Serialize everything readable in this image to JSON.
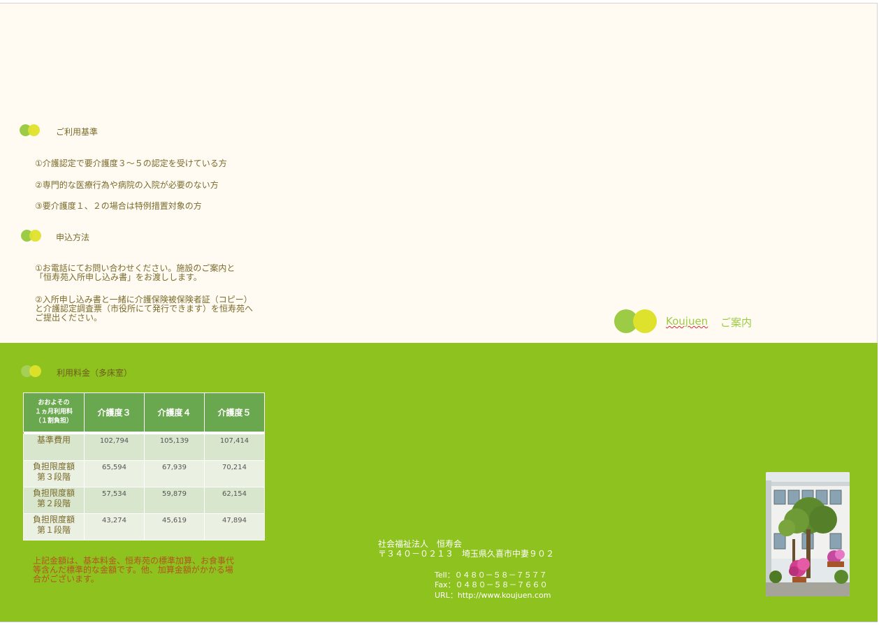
{
  "criteria": {
    "heading": "ご利用基準",
    "items": [
      "①介護認定で要介護度３～５の認定を受けている方",
      "②専門的な医療行為や病院の入院が必要のない方",
      "③要介護度１、２の場合は特例措置対象の方"
    ]
  },
  "application": {
    "heading": "申込方法",
    "step1": "①お電話にてお問い合わせください。施設のご案内と\n「恒寿苑入所申し込み書」をお渡しします。",
    "step2": "②入所申し込み書と一緒に介護保険被保険者証（コピー）\nと介護認定調査票（市役所にて発行できます）を恒寿苑へ\nご提出ください。"
  },
  "brand": {
    "name": "Koujuen",
    "guide": "ご案内"
  },
  "fees": {
    "heading": "利用料金（多床室）",
    "header_first": "おおよその\n１ヵ月利用料\n（１割負担）",
    "levels": [
      "介護度３",
      "介護度４",
      "介護度５"
    ],
    "rows": [
      {
        "label": "基準費用",
        "values": [
          "102,794",
          "105,139",
          "107,414"
        ]
      },
      {
        "label": "負担限度額\n第３段階",
        "values": [
          "65,594",
          "67,939",
          "70,214"
        ]
      },
      {
        "label": "負担限度額\n第２段階",
        "values": [
          "57,534",
          "59,879",
          "62,154"
        ]
      },
      {
        "label": "負担限度額\n第１段階",
        "values": [
          "43,274",
          "45,619",
          "47,894"
        ]
      }
    ],
    "note": "上記金額は、基本料金、恒寿苑の標準加算、お食事代\n等含んだ標準的な金額です。他、加算金額がかかる場\n合がございます。"
  },
  "organization": {
    "name": "社会福祉法人　恒寿会",
    "address": "〒３４０－０２１３　埼玉県久喜市中妻９０２",
    "tel": "Tell：０４８０－５８－７５７７",
    "fax": "Fax：０４８０－５８－７６６０",
    "url": "URL：http://www.koujuen.com"
  },
  "colors": {
    "green_band": "#8dc21f",
    "cream": "#fffbf3",
    "dot_green": "#9ccc45",
    "dot_yellow": "#dfe22c",
    "text_brown": "#7a6a2a",
    "table_header": "#6aa84f"
  }
}
